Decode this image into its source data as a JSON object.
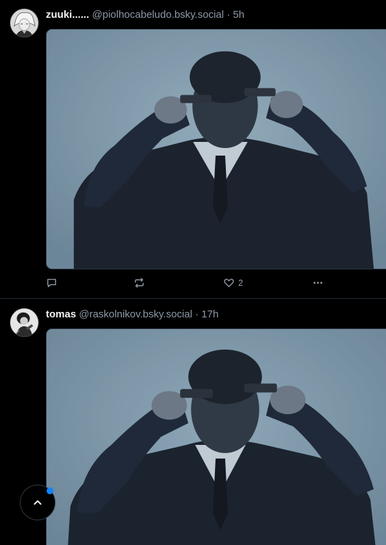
{
  "feed": {
    "posts": [
      {
        "author": {
          "display_name": "zuuki......",
          "handle": "@piolhocabeludo.bsky.social",
          "avatar_icon": "avatar-manga-character"
        },
        "separator": "·",
        "time_ago": "5h",
        "media": {
          "kind": "image",
          "icon": "photo-man-in-suit"
        },
        "actions": {
          "reply_icon": "reply-icon",
          "repost_icon": "repost-icon",
          "like_icon": "heart-icon",
          "like_count": "2",
          "more_icon": "more-icon"
        }
      },
      {
        "author": {
          "display_name": "tomas",
          "handle": "@raskolnikov.bsky.social",
          "avatar_icon": "avatar-illustration"
        },
        "separator": "·",
        "time_ago": "17h",
        "media": {
          "kind": "image",
          "icon": "photo-man-in-suit"
        }
      }
    ]
  },
  "scroll_to_top": {
    "icon": "chevron-up-icon",
    "has_notification": true
  },
  "colors": {
    "background": "#000000",
    "text_primary": "#f1f3f5",
    "text_secondary": "#8d99a7",
    "divider": "#1f2a36",
    "accent": "#1083fe"
  }
}
